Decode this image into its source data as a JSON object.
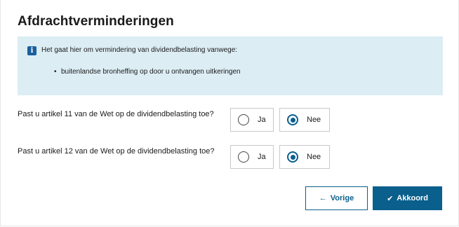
{
  "page": {
    "title": "Afdrachtverminderingen"
  },
  "info": {
    "icon": "info-icon",
    "text": "Het gaat hier om vermindering van dividendbelasting vanwege:",
    "items": [
      "buitenlandse bronheffing op door u ontvangen uitkeringen"
    ]
  },
  "questions": [
    {
      "label": "Past u artikel 11 van de Wet op de dividendbelasting toe?",
      "options": [
        {
          "label": "Ja",
          "checked": false
        },
        {
          "label": "Nee",
          "checked": true
        }
      ]
    },
    {
      "label": "Past u artikel 12 van de Wet op de dividendbelasting toe?",
      "options": [
        {
          "label": "Ja",
          "checked": false
        },
        {
          "label": "Nee",
          "checked": true
        }
      ]
    }
  ],
  "buttons": {
    "prev_label": "Vorige",
    "prev_icon": "arrow-left-icon",
    "ok_label": "Akkoord",
    "ok_icon": "checkmark-icon"
  },
  "colors": {
    "accent": "#0a5f8c",
    "info_background": "#dcedf4"
  }
}
